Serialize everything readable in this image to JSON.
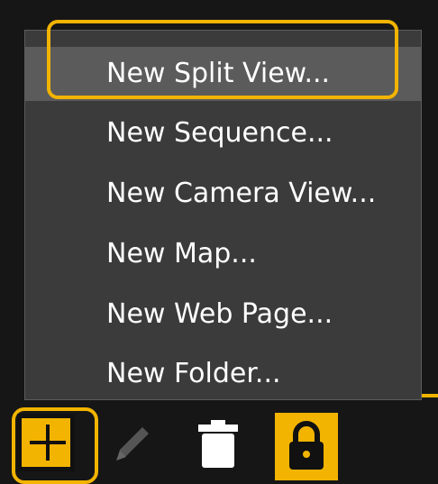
{
  "context_menu": {
    "items": [
      {
        "label": "New Split View..."
      },
      {
        "label": "New Sequence..."
      },
      {
        "label": "New Camera View..."
      },
      {
        "label": "New Map..."
      },
      {
        "label": "New Web Page..."
      },
      {
        "label": "New Folder..."
      }
    ],
    "selected_index": 0
  },
  "toolbar": {
    "buttons": [
      {
        "icon": "plus-icon"
      },
      {
        "icon": "pencil-icon"
      },
      {
        "icon": "trash-icon"
      },
      {
        "icon": "lock-icon"
      }
    ]
  },
  "colors": {
    "accent": "#f2b400",
    "menu_background": "#3b3b3b",
    "selected_background": "#5b5b5b"
  }
}
